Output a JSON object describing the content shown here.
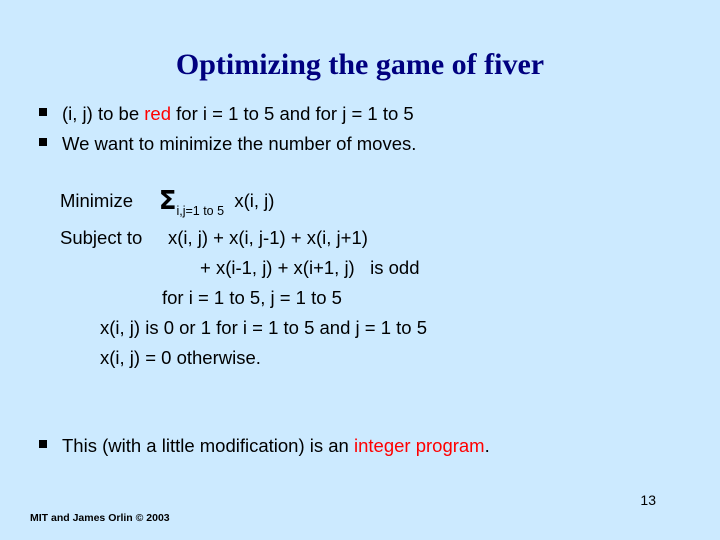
{
  "slide": {
    "title": "Optimizing the game of fiver",
    "bullets": [
      {
        "pre": "(i, j) to be ",
        "highlight": "red",
        "post": " for i = 1 to 5 and for j = 1 to 5"
      },
      {
        "pre": "We want to minimize the number of moves.",
        "highlight": "",
        "post": ""
      }
    ],
    "math": {
      "line1_label": "Minimize",
      "sigma": "Σ",
      "sigma_subscript": "i,j=1 to 5",
      "line1_expr": "x(i, j)",
      "line2": "Subject to     x(i, j) + x(i, j-1) + x(i, j+1)",
      "line3": "+ x(i-1, j) + x(i+1, j)   is odd",
      "line4": "for i = 1 to 5, j = 1 to 5",
      "line5": "x(i, j) is 0 or 1 for i = 1 to 5 and j = 1 to 5",
      "line6": "x(i, j) = 0 otherwise."
    },
    "closing_bullet": {
      "pre": "This (with a little modification) is an ",
      "highlight": "integer program",
      "post": "."
    },
    "page_number": "13",
    "footer": "MIT and James Orlin © 2003"
  }
}
